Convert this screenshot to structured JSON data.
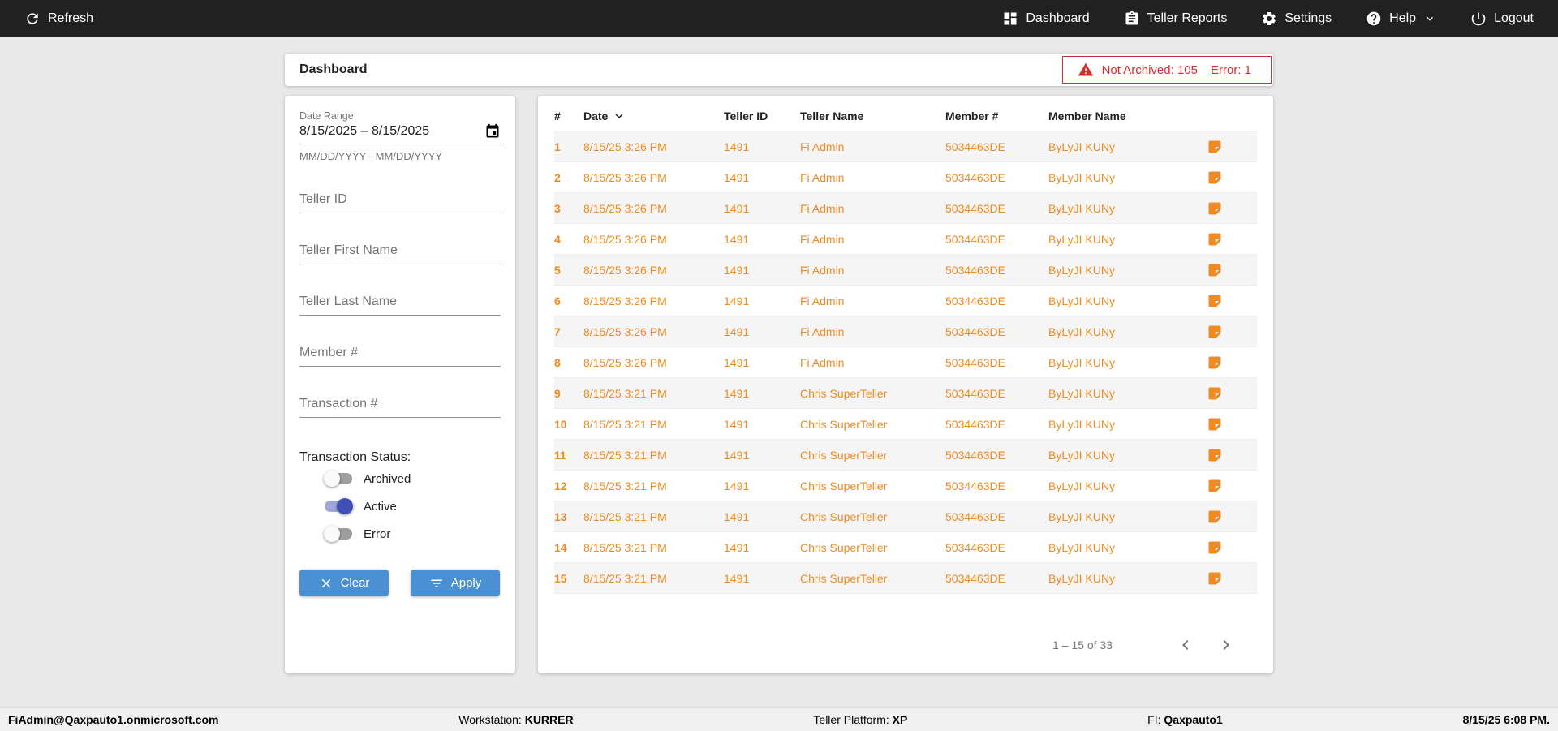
{
  "colors": {
    "topbar_bg": "#212121",
    "row_text_orange": "#ef8b22",
    "button_blue": "#4a90d2",
    "toggle_active_blue": "#3f51b5",
    "alert_red": "#d32f2f"
  },
  "topbar": {
    "refresh_label": "Refresh",
    "items": [
      {
        "label": "Dashboard",
        "icon": "dashboard-icon"
      },
      {
        "label": "Teller Reports",
        "icon": "reports-icon"
      },
      {
        "label": "Settings",
        "icon": "gear-icon"
      },
      {
        "label": "Help",
        "icon": "help-icon",
        "has_chevron": true
      },
      {
        "label": "Logout",
        "icon": "power-icon"
      }
    ]
  },
  "header": {
    "title": "Dashboard",
    "alert": {
      "icon": "warning-icon",
      "items": [
        "Not Archived: 105",
        "Error: 1"
      ]
    }
  },
  "filters": {
    "date_range": {
      "label": "Date Range",
      "value": "8/15/2025 – 8/15/2025",
      "helper": "MM/DD/YYYY - MM/DD/YYYY",
      "icon": "calendar-icon"
    },
    "fields": [
      {
        "placeholder": "Teller ID"
      },
      {
        "placeholder": "Teller First Name"
      },
      {
        "placeholder": "Teller Last Name"
      },
      {
        "placeholder": "Member #"
      },
      {
        "placeholder": "Transaction #"
      }
    ],
    "status_label": "Transaction Status:",
    "toggles": [
      {
        "label": "Archived",
        "on": false
      },
      {
        "label": "Active",
        "on": true
      },
      {
        "label": "Error",
        "on": false
      }
    ],
    "clear_label": "Clear",
    "apply_label": "Apply"
  },
  "table": {
    "columns": [
      {
        "key": "num",
        "label": "#"
      },
      {
        "key": "date",
        "label": "Date"
      },
      {
        "key": "teller_id",
        "label": "Teller ID"
      },
      {
        "key": "teller_name",
        "label": "Teller Name"
      },
      {
        "key": "member_num",
        "label": "Member #"
      },
      {
        "key": "member_name",
        "label": "Member Name"
      }
    ],
    "sort": {
      "column": "Date",
      "direction": "desc"
    },
    "rows": [
      {
        "num": "1",
        "date": "8/15/25 3:26 PM",
        "teller_id": "1491",
        "teller_name": "Fi Admin",
        "member_num": "5034463DE",
        "member_name": "ByLyJI KUNy"
      },
      {
        "num": "2",
        "date": "8/15/25 3:26 PM",
        "teller_id": "1491",
        "teller_name": "Fi Admin",
        "member_num": "5034463DE",
        "member_name": "ByLyJI KUNy"
      },
      {
        "num": "3",
        "date": "8/15/25 3:26 PM",
        "teller_id": "1491",
        "teller_name": "Fi Admin",
        "member_num": "5034463DE",
        "member_name": "ByLyJI KUNy"
      },
      {
        "num": "4",
        "date": "8/15/25 3:26 PM",
        "teller_id": "1491",
        "teller_name": "Fi Admin",
        "member_num": "5034463DE",
        "member_name": "ByLyJI KUNy"
      },
      {
        "num": "5",
        "date": "8/15/25 3:26 PM",
        "teller_id": "1491",
        "teller_name": "Fi Admin",
        "member_num": "5034463DE",
        "member_name": "ByLyJI KUNy"
      },
      {
        "num": "6",
        "date": "8/15/25 3:26 PM",
        "teller_id": "1491",
        "teller_name": "Fi Admin",
        "member_num": "5034463DE",
        "member_name": "ByLyJI KUNy"
      },
      {
        "num": "7",
        "date": "8/15/25 3:26 PM",
        "teller_id": "1491",
        "teller_name": "Fi Admin",
        "member_num": "5034463DE",
        "member_name": "ByLyJI KUNy"
      },
      {
        "num": "8",
        "date": "8/15/25 3:26 PM",
        "teller_id": "1491",
        "teller_name": "Fi Admin",
        "member_num": "5034463DE",
        "member_name": "ByLyJI KUNy"
      },
      {
        "num": "9",
        "date": "8/15/25 3:21 PM",
        "teller_id": "1491",
        "teller_name": "Chris SuperTeller",
        "member_num": "5034463DE",
        "member_name": "ByLyJI KUNy"
      },
      {
        "num": "10",
        "date": "8/15/25 3:21 PM",
        "teller_id": "1491",
        "teller_name": "Chris SuperTeller",
        "member_num": "5034463DE",
        "member_name": "ByLyJI KUNy"
      },
      {
        "num": "11",
        "date": "8/15/25 3:21 PM",
        "teller_id": "1491",
        "teller_name": "Chris SuperTeller",
        "member_num": "5034463DE",
        "member_name": "ByLyJI KUNy"
      },
      {
        "num": "12",
        "date": "8/15/25 3:21 PM",
        "teller_id": "1491",
        "teller_name": "Chris SuperTeller",
        "member_num": "5034463DE",
        "member_name": "ByLyJI KUNy"
      },
      {
        "num": "13",
        "date": "8/15/25 3:21 PM",
        "teller_id": "1491",
        "teller_name": "Chris SuperTeller",
        "member_num": "5034463DE",
        "member_name": "ByLyJI KUNy"
      },
      {
        "num": "14",
        "date": "8/15/25 3:21 PM",
        "teller_id": "1491",
        "teller_name": "Chris SuperTeller",
        "member_num": "5034463DE",
        "member_name": "ByLyJI KUNy"
      },
      {
        "num": "15",
        "date": "8/15/25 3:21 PM",
        "teller_id": "1491",
        "teller_name": "Chris SuperTeller",
        "member_num": "5034463DE",
        "member_name": "ByLyJI KUNy"
      }
    ],
    "row_icon": "note-icon",
    "pagination": {
      "range": "1 – 15 of 33"
    }
  },
  "footer": {
    "user": "FiAdmin@Qaxpauto1.onmicrosoft.com",
    "workstation_label": "Workstation:",
    "workstation": "KURRER",
    "platform_label": "Teller Platform:",
    "platform": "XP",
    "fi_label": "FI:",
    "fi": "Qaxpauto1",
    "datetime": "8/15/25 6:08 PM."
  }
}
